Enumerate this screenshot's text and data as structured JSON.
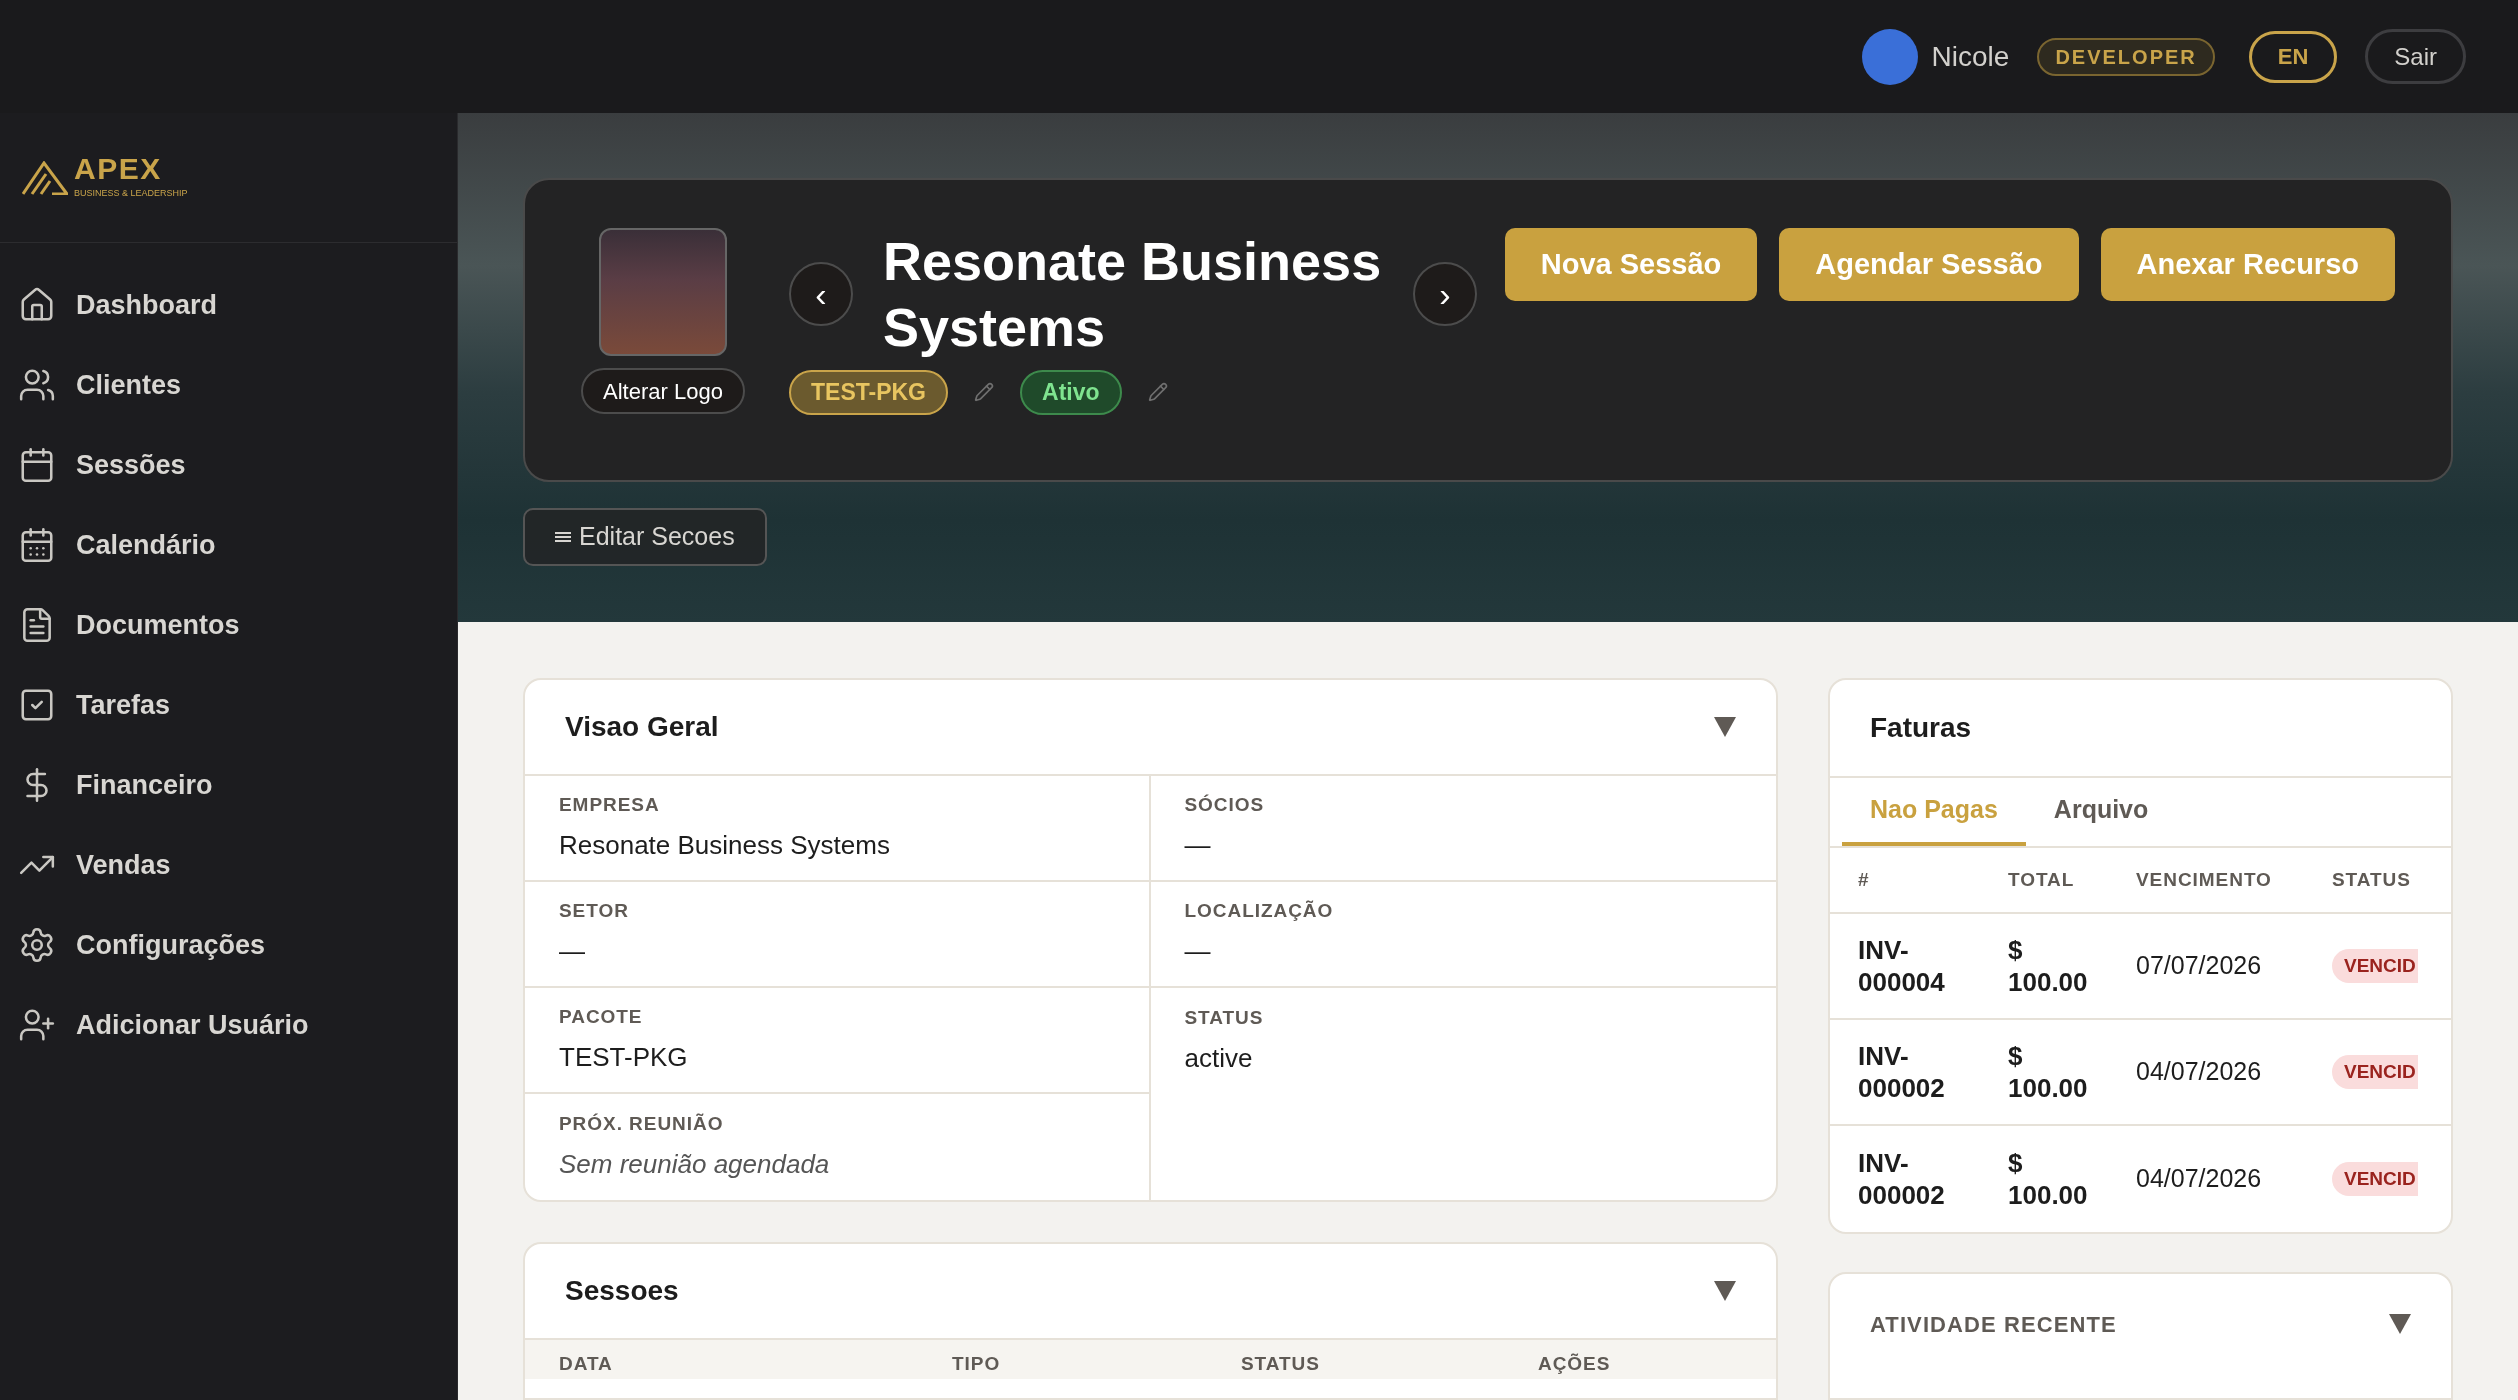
{
  "topbar": {
    "user_name": "Nicole",
    "role": "DEVELOPER",
    "language": "EN",
    "logout": "Sair"
  },
  "sidebar": {
    "logo": {
      "name": "APEX",
      "tagline": "BUSINESS & LEADERSHIP"
    },
    "items": [
      {
        "label": "Dashboard",
        "selected": false
      },
      {
        "label": "Clientes",
        "selected": false
      },
      {
        "label": "Sessões",
        "selected": false
      },
      {
        "label": "Calendário",
        "selected": false
      },
      {
        "label": "Documentos",
        "selected": false
      },
      {
        "label": "Tarefas",
        "selected": false
      },
      {
        "label": "Financeiro",
        "selected": false
      },
      {
        "label": "Vendas",
        "selected": false
      },
      {
        "label": "Configurações",
        "selected": false
      },
      {
        "label": "Adicionar Usuário",
        "selected": false
      }
    ]
  },
  "header": {
    "change_logo": "Alterar Logo",
    "prev": "‹",
    "next": "›",
    "title": "Resonate Business Systems",
    "badges": [
      {
        "kind": "package",
        "label": "TEST-PKG"
      },
      {
        "kind": "status",
        "label": "Ativo"
      }
    ],
    "actions": [
      "Nova Sessão",
      "Agendar Sessão",
      "Anexar Recurso"
    ],
    "edit_sections": "Editar Secoes"
  },
  "overview": {
    "title": "Visao Geral",
    "fields": [
      {
        "label": "EMPRESA",
        "value": "Resonate Business Systems",
        "kind": "value"
      },
      {
        "label": "SÓCIOS",
        "value": "—",
        "kind": "value"
      },
      {
        "label": "SETOR",
        "value": "—",
        "kind": "value"
      },
      {
        "label": "LOCALIZAÇÃO",
        "value": "—",
        "kind": "value"
      },
      {
        "label": "PACOTE",
        "value": "TEST-PKG",
        "kind": "value"
      },
      {
        "label": "STATUS",
        "value": "active",
        "kind": "value"
      },
      {
        "label": "PRÓX. REUNIÃO",
        "value": "Sem reunião agendada",
        "kind": "note"
      }
    ]
  },
  "sessions": {
    "title": "Sessoes",
    "columns": [
      "DATA",
      "TIPO",
      "STATUS",
      "AÇÕES"
    ]
  },
  "invoices": {
    "title": "Faturas",
    "tabs": [
      {
        "label": "Nao Pagas",
        "selected": true
      },
      {
        "label": "Arquivo",
        "selected": false
      }
    ],
    "columns": [
      "#",
      "TOTAL",
      "VENCIMENTO",
      "STATUS"
    ],
    "rows": [
      {
        "number": "INV-000004",
        "total": "$ 100.00",
        "due": "07/07/2026",
        "status": "VENCID"
      },
      {
        "number": "INV-000002",
        "total": "$ 100.00",
        "due": "04/07/2026",
        "status": "VENCID"
      },
      {
        "number": "INV-000002",
        "total": "$ 100.00",
        "due": "04/07/2026",
        "status": "VENCID"
      }
    ]
  },
  "activity": {
    "title": "ATIVIDADE RECENTE"
  }
}
